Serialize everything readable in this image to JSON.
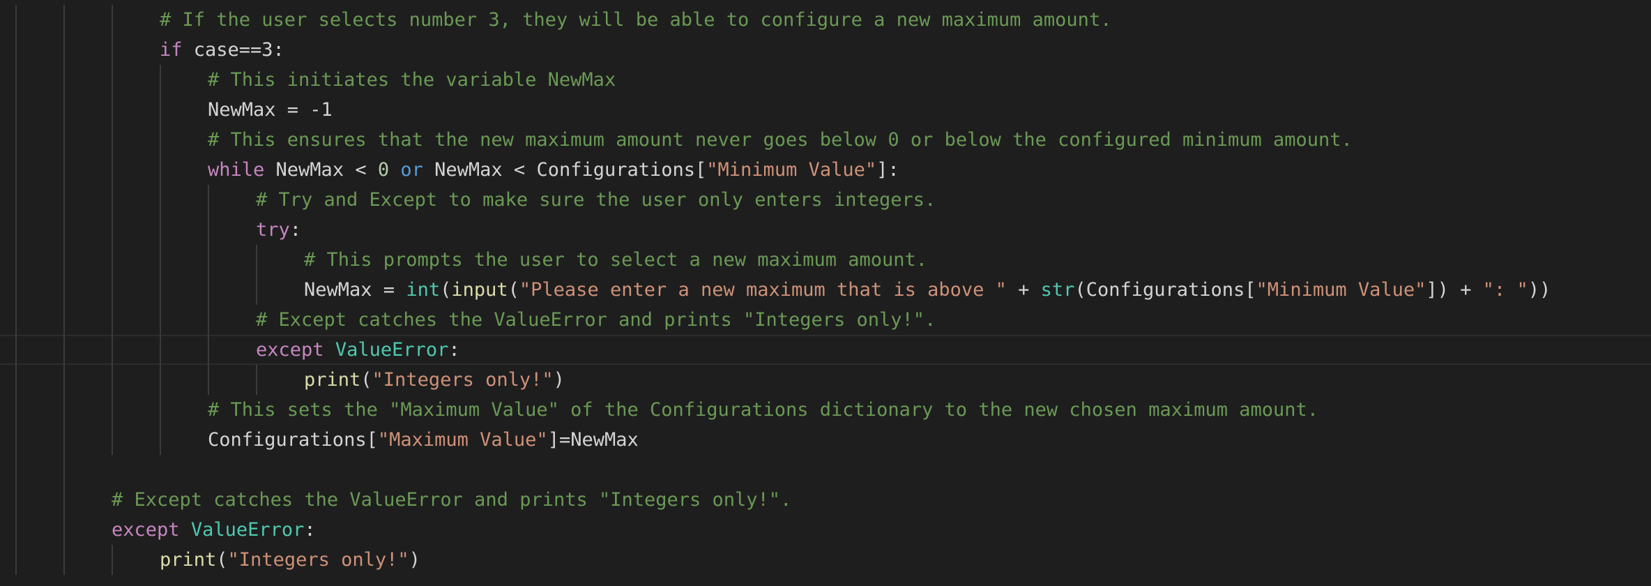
{
  "editor": {
    "language": "python",
    "theme": "dark",
    "colors": {
      "background": "#1e1e1e",
      "comment": "#6a9955",
      "keyword": "#c586c0",
      "operator_keyword": "#569cd6",
      "plain": "#d4d4d4",
      "number": "#b5cea8",
      "string": "#ce9178",
      "function": "#dcdcaa",
      "class": "#4ec9b0"
    },
    "lines": [
      {
        "indent": 3,
        "tokens": [
          {
            "t": "comment",
            "v": "# If the user selects number 3, they will be able to configure a new maximum amount."
          }
        ]
      },
      {
        "indent": 3,
        "tokens": [
          {
            "t": "kw",
            "v": "if"
          },
          {
            "t": "plain",
            "v": " case==3:"
          }
        ]
      },
      {
        "indent": 4,
        "tokens": [
          {
            "t": "comment",
            "v": "# This initiates the variable NewMax"
          }
        ]
      },
      {
        "indent": 4,
        "tokens": [
          {
            "t": "plain",
            "v": "NewMax = -1"
          }
        ]
      },
      {
        "indent": 4,
        "tokens": [
          {
            "t": "comment",
            "v": "# This ensures that the new maximum amount never goes below 0 or below the configured minimum amount."
          }
        ]
      },
      {
        "indent": 4,
        "tokens": [
          {
            "t": "kw",
            "v": "while"
          },
          {
            "t": "plain",
            "v": " NewMax < "
          },
          {
            "t": "num",
            "v": "0"
          },
          {
            "t": "plain",
            "v": " "
          },
          {
            "t": "bool",
            "v": "or"
          },
          {
            "t": "plain",
            "v": " NewMax < Configurations["
          },
          {
            "t": "str",
            "v": "\"Minimum Value\""
          },
          {
            "t": "plain",
            "v": "]:"
          }
        ]
      },
      {
        "indent": 5,
        "tokens": [
          {
            "t": "comment",
            "v": "# Try and Except to make sure the user only enters integers."
          }
        ]
      },
      {
        "indent": 5,
        "tokens": [
          {
            "t": "kw",
            "v": "try"
          },
          {
            "t": "plain",
            "v": ":"
          }
        ]
      },
      {
        "indent": 6,
        "tokens": [
          {
            "t": "comment",
            "v": "# This prompts the user to select a new maximum amount."
          }
        ]
      },
      {
        "indent": 6,
        "tokens": [
          {
            "t": "plain",
            "v": "NewMax = "
          },
          {
            "t": "builtin",
            "v": "int"
          },
          {
            "t": "plain",
            "v": "("
          },
          {
            "t": "fn",
            "v": "input"
          },
          {
            "t": "plain",
            "v": "("
          },
          {
            "t": "str",
            "v": "\"Please enter a new maximum that is above \""
          },
          {
            "t": "plain",
            "v": " + "
          },
          {
            "t": "builtin",
            "v": "str"
          },
          {
            "t": "plain",
            "v": "(Configurations["
          },
          {
            "t": "str",
            "v": "\"Minimum Value\""
          },
          {
            "t": "plain",
            "v": "]) + "
          },
          {
            "t": "str",
            "v": "\": \""
          },
          {
            "t": "plain",
            "v": "))"
          }
        ]
      },
      {
        "indent": 5,
        "tokens": [
          {
            "t": "comment",
            "v": "# Except catches the ValueError and prints \"Integers only!\"."
          }
        ]
      },
      {
        "indent": 5,
        "current": true,
        "tokens": [
          {
            "t": "kw",
            "v": "except"
          },
          {
            "t": "plain",
            "v": " "
          },
          {
            "t": "cls",
            "v": "ValueError"
          },
          {
            "t": "plain",
            "v": ":"
          }
        ]
      },
      {
        "indent": 6,
        "tokens": [
          {
            "t": "fn",
            "v": "print"
          },
          {
            "t": "plain",
            "v": "("
          },
          {
            "t": "str",
            "v": "\"Integers only!\""
          },
          {
            "t": "plain",
            "v": ")"
          }
        ]
      },
      {
        "indent": 4,
        "tokens": [
          {
            "t": "comment",
            "v": "# This sets the \"Maximum Value\" of the Configurations dictionary to the new chosen maximum amount."
          }
        ]
      },
      {
        "indent": 4,
        "tokens": [
          {
            "t": "plain",
            "v": "Configurations["
          },
          {
            "t": "str",
            "v": "\"Maximum Value\""
          },
          {
            "t": "plain",
            "v": "]=NewMax"
          }
        ]
      },
      {
        "indent": 2,
        "tokens": []
      },
      {
        "indent": 2,
        "tokens": [
          {
            "t": "comment",
            "v": "# Except catches the ValueError and prints \"Integers only!\"."
          }
        ]
      },
      {
        "indent": 2,
        "tokens": [
          {
            "t": "kw",
            "v": "except"
          },
          {
            "t": "plain",
            "v": " "
          },
          {
            "t": "cls",
            "v": "ValueError"
          },
          {
            "t": "plain",
            "v": ":"
          }
        ]
      },
      {
        "indent": 3,
        "tokens": [
          {
            "t": "fn",
            "v": "print"
          },
          {
            "t": "plain",
            "v": "("
          },
          {
            "t": "str",
            "v": "\"Integers only!\""
          },
          {
            "t": "plain",
            "v": ")"
          }
        ]
      }
    ]
  }
}
